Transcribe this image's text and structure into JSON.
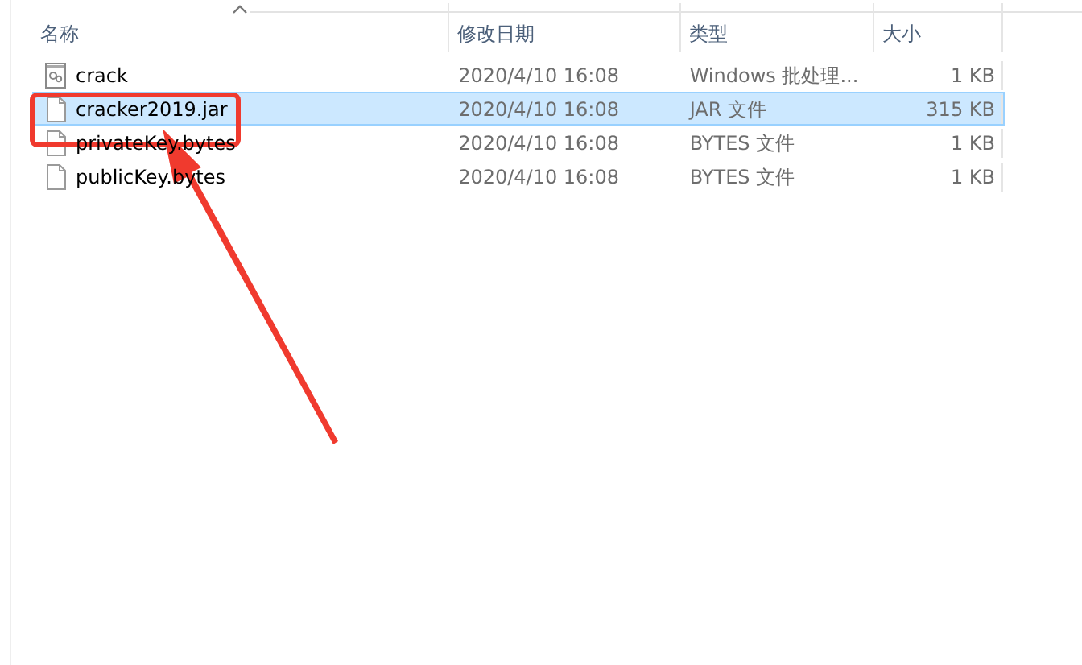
{
  "columns": [
    {
      "label": "名称",
      "sorted": true
    },
    {
      "label": "修改日期",
      "sorted": false
    },
    {
      "label": "类型",
      "sorted": false
    },
    {
      "label": "大小",
      "sorted": false
    }
  ],
  "files": [
    {
      "name": "crack",
      "modified": "2020/4/10 16:08",
      "type": "Windows 批处理...",
      "size": "1 KB",
      "kind": "batch",
      "selected": false
    },
    {
      "name": "cracker2019.jar",
      "modified": "2020/4/10 16:08",
      "type": "JAR 文件",
      "size": "315 KB",
      "kind": "file",
      "selected": true
    },
    {
      "name": "privateKey.bytes",
      "modified": "2020/4/10 16:08",
      "type": "BYTES 文件",
      "size": "1 KB",
      "kind": "file",
      "selected": false
    },
    {
      "name": "publicKey.bytes",
      "modified": "2020/4/10 16:08",
      "type": "BYTES 文件",
      "size": "1 KB",
      "kind": "file",
      "selected": false
    }
  ]
}
